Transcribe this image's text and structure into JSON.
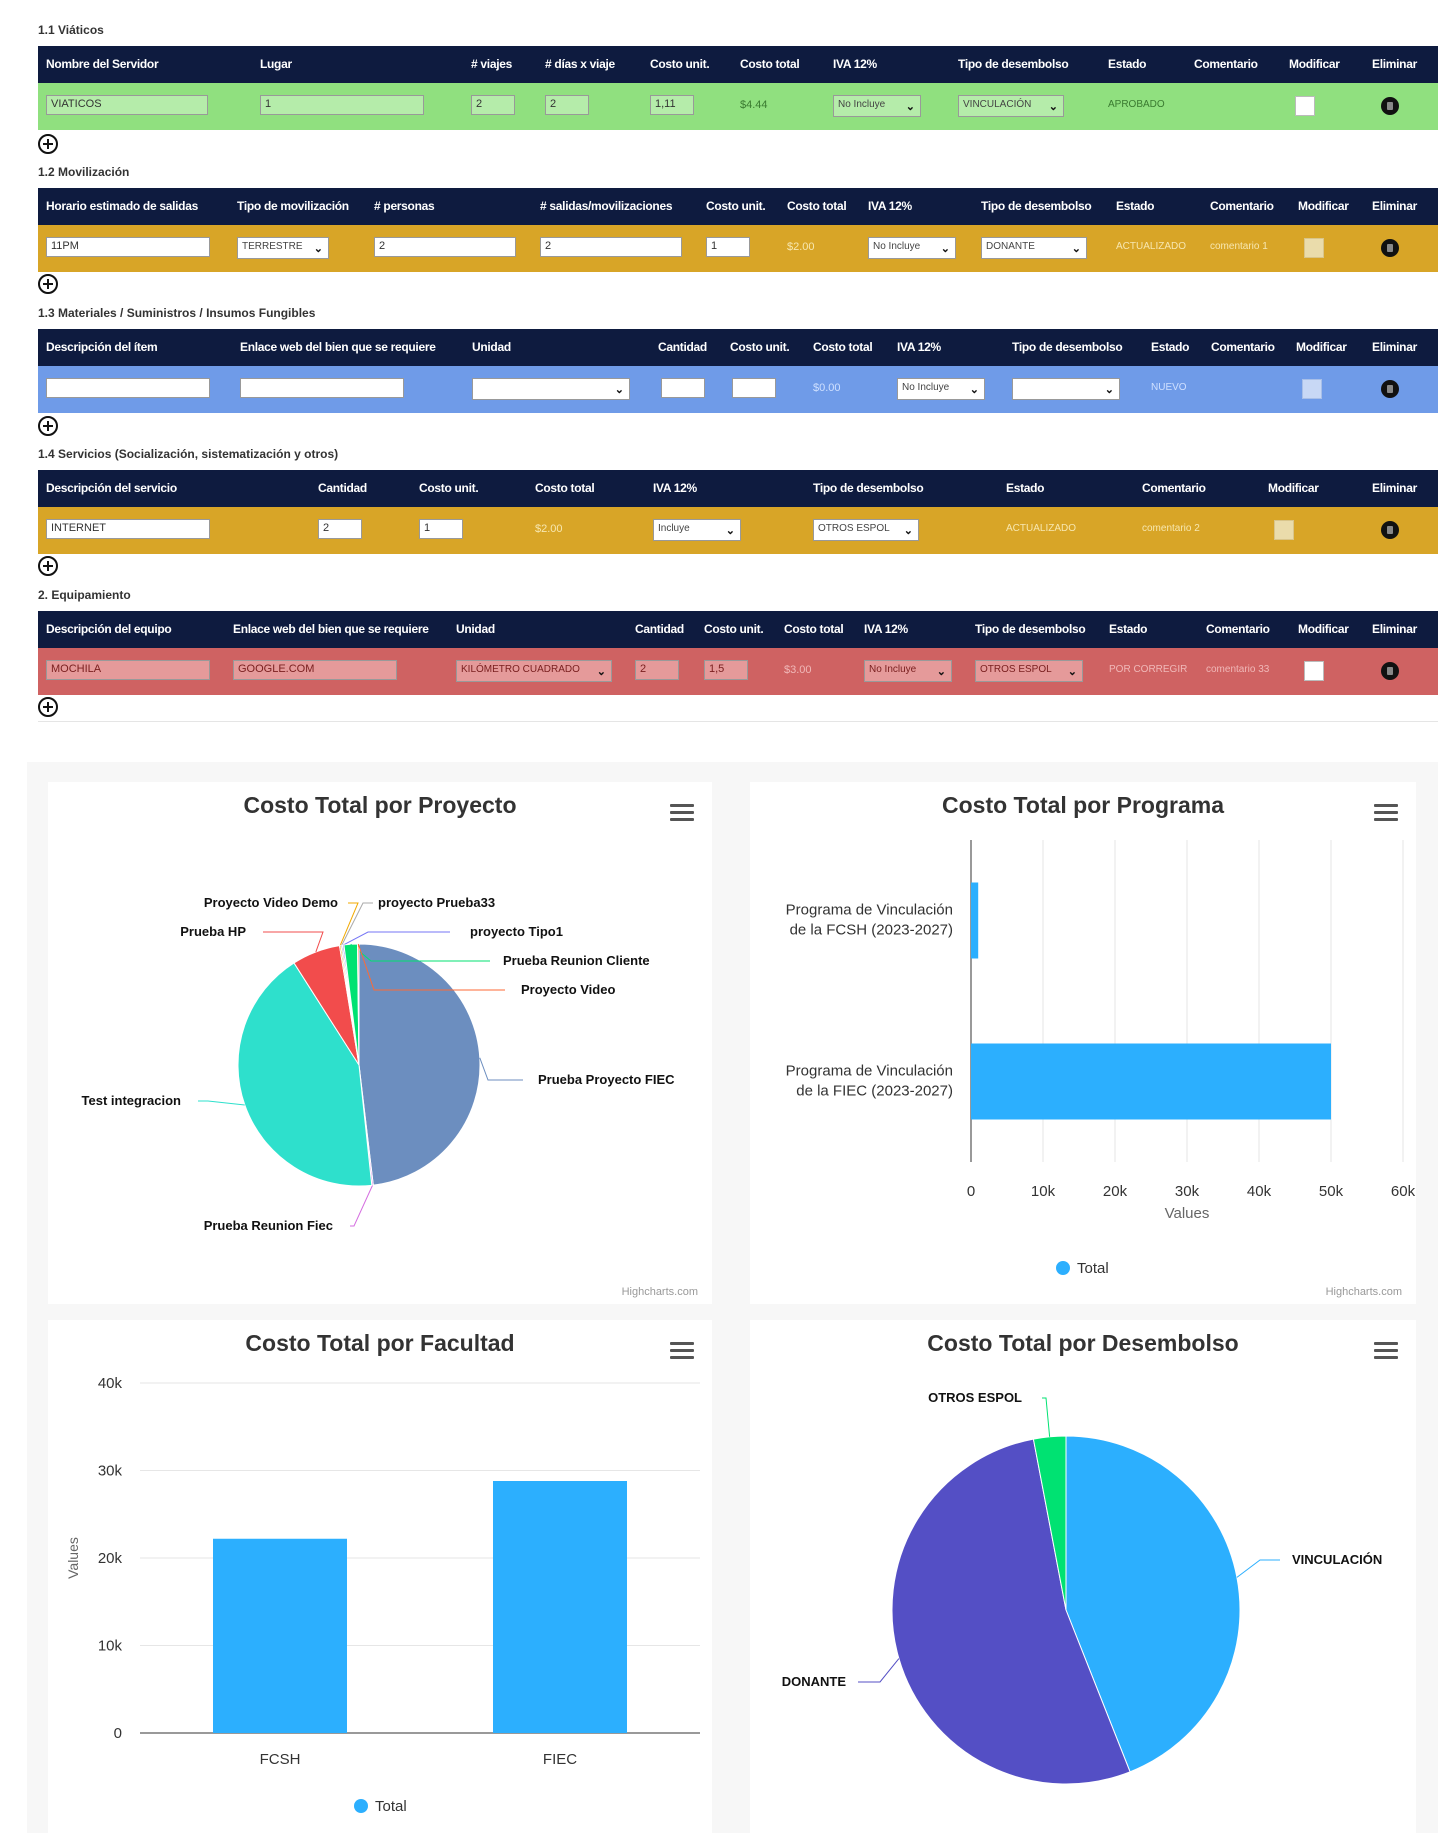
{
  "colors": {
    "header": "#0e1b3f",
    "green_row": "#90e07f",
    "orange_row": "#d8a527",
    "blue_row": "#6f9be8",
    "red_row": "#cf6262",
    "bar": "#2caffe"
  },
  "sections": {
    "viaticos": {
      "title": "1.1 Viáticos",
      "headers": [
        "Nombre del Servidor",
        "Lugar",
        "# viajes",
        "# días x viaje",
        "Costo unit.",
        "Costo total",
        "IVA 12%",
        "Tipo de desembolso",
        "Estado",
        "Comentario",
        "Modificar",
        "Eliminar"
      ],
      "row": {
        "nombre": "VIATICOS",
        "lugar": "1",
        "viajes": "2",
        "dias": "2",
        "costo_unit": "1,11",
        "costo_total": "$4.44",
        "iva": "No Incluye",
        "desembolso": "VINCULACIÓN",
        "estado": "APROBADO",
        "comentario": ""
      }
    },
    "movilizacion": {
      "title": "1.2 Movilización",
      "headers": [
        "Horario estimado de salidas",
        "Tipo de movilización",
        "# personas",
        "# salidas/movilizaciones",
        "Costo unit.",
        "Costo total",
        "IVA 12%",
        "Tipo de desembolso",
        "Estado",
        "Comentario",
        "Modificar",
        "Eliminar"
      ],
      "row": {
        "horario": "11PM",
        "tipo": "TERRESTRE",
        "personas": "2",
        "salidas": "2",
        "costo_unit": "1",
        "costo_total": "$2.00",
        "iva": "No Incluye",
        "desembolso": "DONANTE",
        "estado": "ACTUALIZADO",
        "comentario": "comentario 1"
      }
    },
    "materiales": {
      "title": "1.3 Materiales / Suministros / Insumos Fungibles",
      "headers": [
        "Descripción del ítem",
        "Enlace web del bien que se requiere",
        "Unidad",
        "Cantidad",
        "Costo unit.",
        "Costo total",
        "IVA 12%",
        "Tipo de desembolso",
        "Estado",
        "Comentario",
        "Modificar",
        "Eliminar"
      ],
      "row": {
        "costo_total": "$0.00",
        "iva": "No Incluye",
        "estado": "NUEVO"
      }
    },
    "servicios": {
      "title": "1.4 Servicios (Socialización, sistematización y otros)",
      "headers": [
        "Descripción del servicio",
        "Cantidad",
        "Costo unit.",
        "Costo total",
        "IVA 12%",
        "Tipo de desembolso",
        "Estado",
        "Comentario",
        "Modificar",
        "Eliminar"
      ],
      "row": {
        "descripcion": "INTERNET",
        "cantidad": "2",
        "costo_unit": "1",
        "costo_total": "$2.00",
        "iva": "Incluye",
        "desembolso": "OTROS ESPOL",
        "estado": "ACTUALIZADO",
        "comentario": "comentario 2"
      }
    },
    "equipamiento": {
      "title": "2. Equipamiento",
      "headers": [
        "Descripción del equipo",
        "Enlace web del bien que se requiere",
        "Unidad",
        "Cantidad",
        "Costo unit.",
        "Costo total",
        "IVA 12%",
        "Tipo de desembolso",
        "Estado",
        "Comentario",
        "Modificar",
        "Eliminar"
      ],
      "row": {
        "descripcion": "MOCHILA",
        "enlace": "GOOGLE.COM",
        "unidad": "KILÓMETRO CUADRADO",
        "cantidad": "2",
        "costo_unit": "1,5",
        "costo_total": "$3.00",
        "iva": "No Incluye",
        "desembolso": "OTROS ESPOL",
        "estado": "POR CORREGIR",
        "comentario": "comentario 33"
      }
    }
  },
  "chart_credit": "Highcharts.com",
  "chart_data": [
    {
      "type": "pie",
      "title": "Costo Total por Proyecto",
      "slices": [
        {
          "name": "Prueba Proyecto FIEC",
          "value": 48.5,
          "color": "#6c8ebf"
        },
        {
          "name": "Prueba Reunion Fiec",
          "value": 0.2,
          "color": "#d56ee0"
        },
        {
          "name": "Test integracion",
          "value": 43.0,
          "color": "#2ee0cc"
        },
        {
          "name": "Prueba HP",
          "value": 6.5,
          "color": "#f24c4c"
        },
        {
          "name": "Proyecto Video Demo",
          "value": 0.2,
          "color": "#f2a900"
        },
        {
          "name": "proyecto Prueba33",
          "value": 0.2,
          "color": "#aaaaaa"
        },
        {
          "name": "proyecto Tipo1",
          "value": 0.2,
          "color": "#7575f5"
        },
        {
          "name": "Prueba Reunion Cliente",
          "value": 1.8,
          "color": "#00e272"
        },
        {
          "name": "Proyecto Video",
          "value": 0.2,
          "color": "#fe6a35"
        }
      ]
    },
    {
      "type": "bar",
      "orientation": "horizontal",
      "title": "Costo Total por Programa",
      "categories": [
        "Programa de Vinculación de la FCSH (2023-2027)",
        "Programa de Vinculación de la FIEC (2023-2027)"
      ],
      "series": [
        {
          "name": "Total",
          "values": [
            1000,
            50000
          ]
        }
      ],
      "ticks": [
        "0",
        "10k",
        "20k",
        "30k",
        "40k",
        "50k",
        "60k"
      ],
      "xlim": [
        0,
        60000
      ],
      "ylabel": "Values",
      "legend": "bottom"
    },
    {
      "type": "bar",
      "title": "Costo Total por Facultad",
      "categories": [
        "FCSH",
        "FIEC"
      ],
      "series": [
        {
          "name": "Total",
          "values": [
            22200,
            28800
          ]
        }
      ],
      "ticks": [
        "0",
        "10k",
        "20k",
        "30k",
        "40k"
      ],
      "ylim": [
        0,
        40000
      ],
      "ylabel": "Values",
      "legend": "bottom"
    },
    {
      "type": "pie",
      "title": "Costo Total por Desembolso",
      "slices": [
        {
          "name": "VINCULACIÓN",
          "value": 44,
          "color": "#2caffe"
        },
        {
          "name": "DONANTE",
          "value": 53,
          "color": "#544fc5"
        },
        {
          "name": "OTROS ESPOL",
          "value": 3,
          "color": "#00e272"
        }
      ]
    }
  ]
}
